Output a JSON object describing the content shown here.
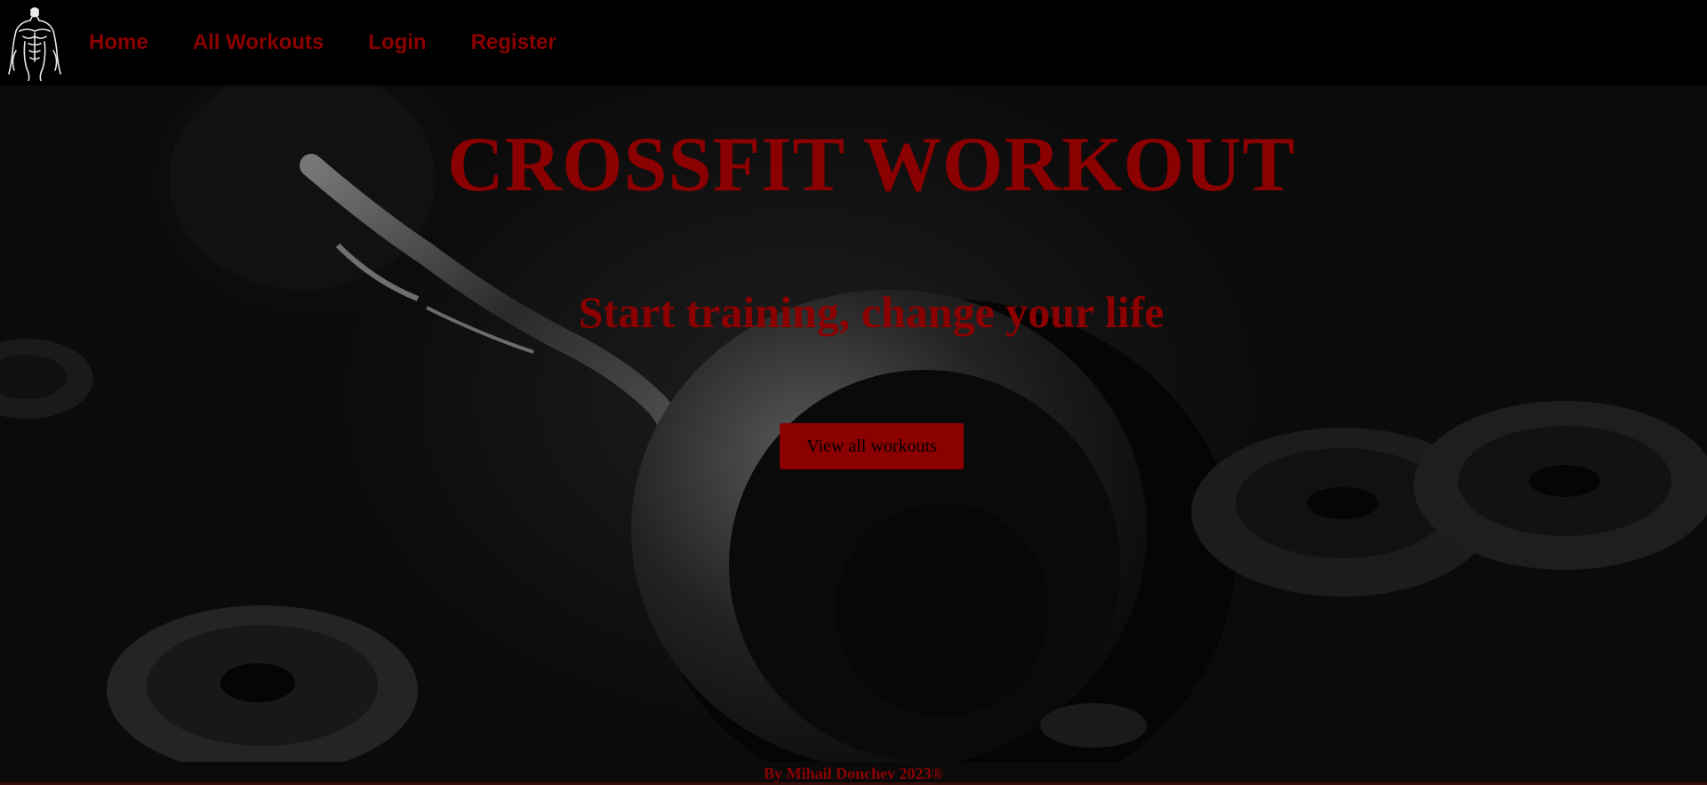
{
  "nav": {
    "logo_icon": "muscleman-logo-icon",
    "links": [
      {
        "label": "Home"
      },
      {
        "label": "All Workouts"
      },
      {
        "label": "Login"
      },
      {
        "label": "Register"
      }
    ]
  },
  "hero": {
    "title": "CROSSFIT WORKOUT",
    "subtitle": "Start training, change your life",
    "cta_label": "View all workouts"
  },
  "footer": {
    "text": "By Mihail Donchev 2023®"
  },
  "colors": {
    "brand_red": "#8b0000",
    "nav_bg": "#000000",
    "hero_bg": "#121212"
  }
}
